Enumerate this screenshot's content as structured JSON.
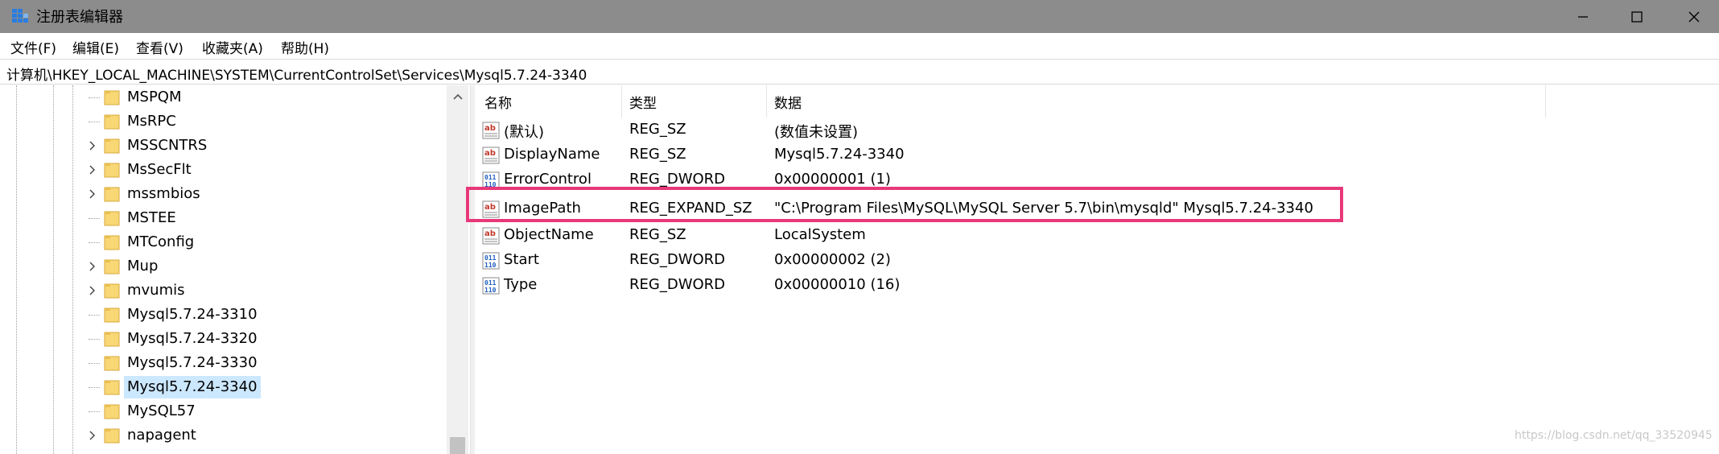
{
  "window": {
    "title": "注册表编辑器",
    "minimize_icon": "minimize-icon",
    "maximize_icon": "maximize-icon",
    "close_icon": "close-icon"
  },
  "menu": {
    "file": "文件(F)",
    "edit": "编辑(E)",
    "view": "查看(V)",
    "favorites": "收藏夹(A)",
    "help": "帮助(H)"
  },
  "address": {
    "path": "计算机\\HKEY_LOCAL_MACHINE\\SYSTEM\\CurrentControlSet\\Services\\Mysql5.7.24-3340"
  },
  "tree": {
    "items": [
      {
        "label": "MSPQM",
        "expandable": false
      },
      {
        "label": "MsRPC",
        "expandable": false
      },
      {
        "label": "MSSCNTRS",
        "expandable": true
      },
      {
        "label": "MsSecFlt",
        "expandable": true
      },
      {
        "label": "mssmbios",
        "expandable": true
      },
      {
        "label": "MSTEE",
        "expandable": false
      },
      {
        "label": "MTConfig",
        "expandable": false
      },
      {
        "label": "Mup",
        "expandable": true
      },
      {
        "label": "mvumis",
        "expandable": true
      },
      {
        "label": "Mysql5.7.24-3310",
        "expandable": false
      },
      {
        "label": "Mysql5.7.24-3320",
        "expandable": false
      },
      {
        "label": "Mysql5.7.24-3330",
        "expandable": false
      },
      {
        "label": "Mysql5.7.24-3340",
        "expandable": false,
        "selected": true
      },
      {
        "label": "MySQL57",
        "expandable": false
      },
      {
        "label": "napagent",
        "expandable": true
      }
    ]
  },
  "values": {
    "headers": {
      "name": "名称",
      "type": "类型",
      "data": "数据"
    },
    "rows": [
      {
        "icon": "string-value-icon",
        "name": "(默认)",
        "type": "REG_SZ",
        "data": "(数值未设置)"
      },
      {
        "icon": "string-value-icon",
        "name": "DisplayName",
        "type": "REG_SZ",
        "data": "Mysql5.7.24-3340"
      },
      {
        "icon": "binary-value-icon",
        "name": "ErrorControl",
        "type": "REG_DWORD",
        "data": "0x00000001 (1)"
      },
      {
        "icon": "string-value-icon",
        "name": "ImagePath",
        "type": "REG_EXPAND_SZ",
        "data": "\"C:\\Program Files\\MySQL\\MySQL Server 5.7\\bin\\mysqld\" Mysql5.7.24-3340"
      },
      {
        "icon": "string-value-icon",
        "name": "ObjectName",
        "type": "REG_SZ",
        "data": "LocalSystem"
      },
      {
        "icon": "binary-value-icon",
        "name": "Start",
        "type": "REG_DWORD",
        "data": "0x00000002 (2)"
      },
      {
        "icon": "binary-value-icon",
        "name": "Type",
        "type": "REG_DWORD",
        "data": "0x00000010 (16)"
      }
    ]
  },
  "annotation": {
    "highlight_color": "#e8387a"
  },
  "watermark": "https://blog.csdn.net/qq_33520945",
  "colors": {
    "titlebar": "#8c8c8c",
    "selection": "#cce8ff",
    "folder": "#f8d775"
  }
}
